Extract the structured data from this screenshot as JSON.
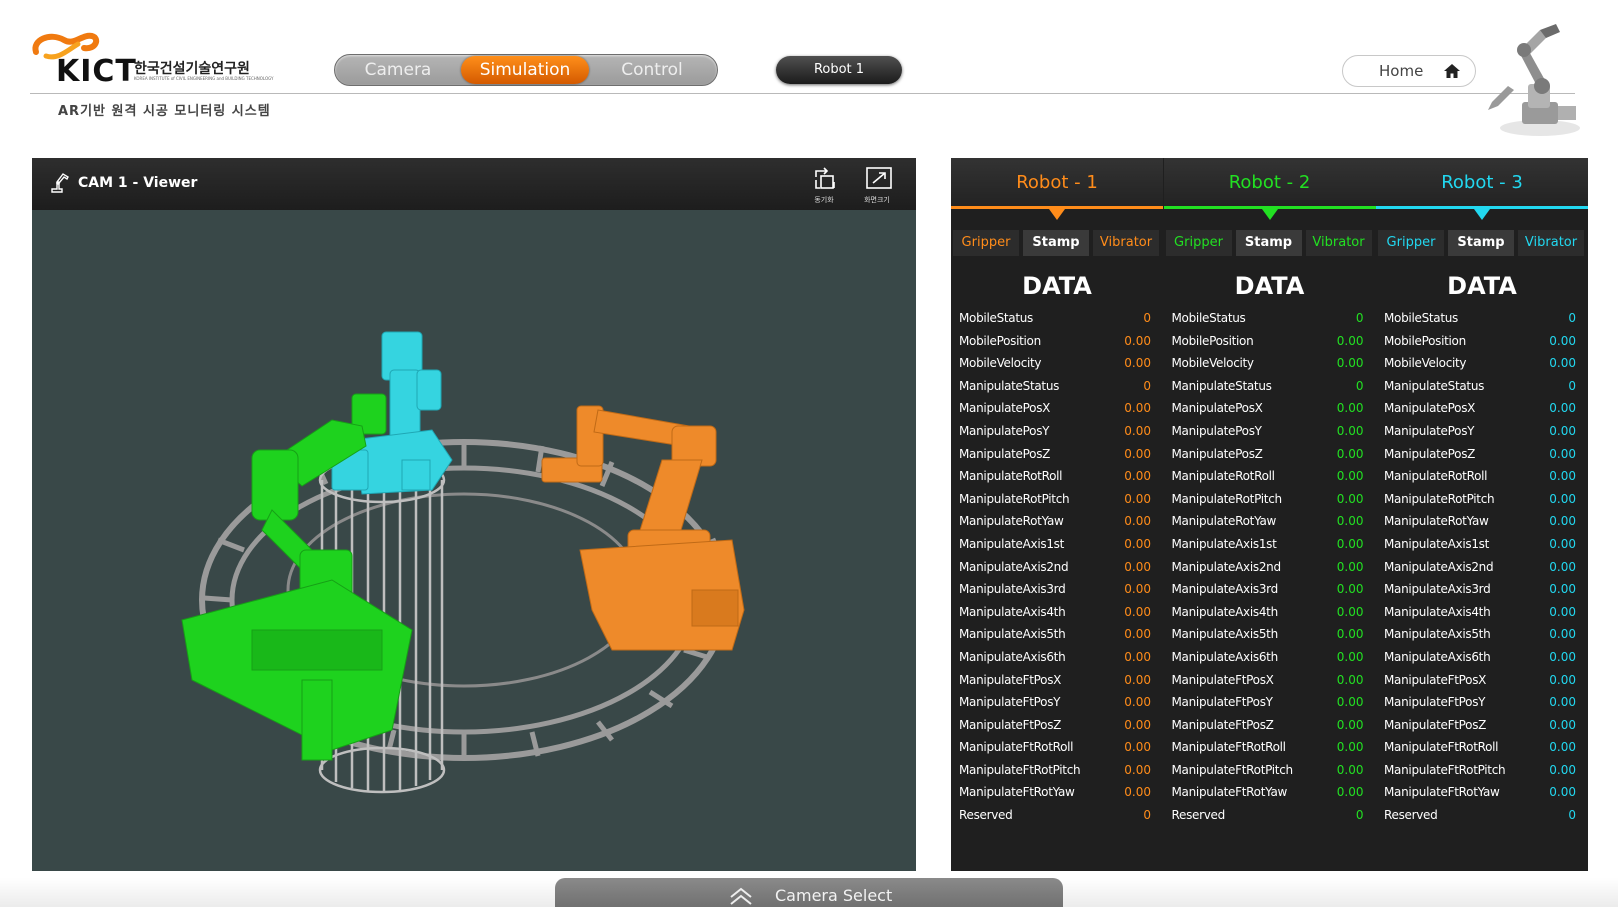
{
  "header": {
    "logo_text": "KICT",
    "logo_korean": "한국건설기술연구원",
    "logo_english": "KOREA INSTITUTE of CIVIL ENGINEERING and BUILDING TECHNOLOGY",
    "subtitle": "AR기반 원격 시공 모니터링 시스템",
    "modes": [
      {
        "label": "Camera"
      },
      {
        "label": "Simulation",
        "active": true
      },
      {
        "label": "Control"
      }
    ],
    "robot_select": "Robot 1",
    "home_label": "Home",
    "icons": {
      "home": "home-icon",
      "logo": "kict-logo-icon",
      "robot_arm": "robot-arm-icon"
    }
  },
  "viewer": {
    "title": "CAM 1 - Viewer",
    "buttons": [
      {
        "label": "동기화",
        "icon": "sync-icon"
      },
      {
        "label": "화면크기",
        "icon": "fullscreen-icon"
      }
    ]
  },
  "robots": [
    {
      "name": "Robot - 1",
      "color": "#ff8c1a",
      "tools": [
        "Gripper",
        "Stamp",
        "Vibrator"
      ],
      "selected_tool": "Stamp",
      "data_title": "DATA",
      "rows": [
        [
          "MobileStatus",
          "0"
        ],
        [
          "MobilePosition",
          "0.00"
        ],
        [
          "MobileVelocity",
          "0.00"
        ],
        [
          "ManipulateStatus",
          "0"
        ],
        [
          "ManipulatePosX",
          "0.00"
        ],
        [
          "ManipulatePosY",
          "0.00"
        ],
        [
          "ManipulatePosZ",
          "0.00"
        ],
        [
          "ManipulateRotRoll",
          "0.00"
        ],
        [
          "ManipulateRotPitch",
          "0.00"
        ],
        [
          "ManipulateRotYaw",
          "0.00"
        ],
        [
          "ManipulateAxis1st",
          "0.00"
        ],
        [
          "ManipulateAxis2nd",
          "0.00"
        ],
        [
          "ManipulateAxis3rd",
          "0.00"
        ],
        [
          "ManipulateAxis4th",
          "0.00"
        ],
        [
          "ManipulateAxis5th",
          "0.00"
        ],
        [
          "ManipulateAxis6th",
          "0.00"
        ],
        [
          "ManipulateFtPosX",
          "0.00"
        ],
        [
          "ManipulateFtPosY",
          "0.00"
        ],
        [
          "ManipulateFtPosZ",
          "0.00"
        ],
        [
          "ManipulateFtRotRoll",
          "0.00"
        ],
        [
          "ManipulateFtRotPitch",
          "0.00"
        ],
        [
          "ManipulateFtRotYaw",
          "0.00"
        ],
        [
          "Reserved",
          "0"
        ]
      ]
    },
    {
      "name": "Robot - 2",
      "color": "#22e022",
      "tools": [
        "Gripper",
        "Stamp",
        "Vibrator"
      ],
      "selected_tool": "Stamp",
      "data_title": "DATA",
      "rows": [
        [
          "MobileStatus",
          "0"
        ],
        [
          "MobilePosition",
          "0.00"
        ],
        [
          "MobileVelocity",
          "0.00"
        ],
        [
          "ManipulateStatus",
          "0"
        ],
        [
          "ManipulatePosX",
          "0.00"
        ],
        [
          "ManipulatePosY",
          "0.00"
        ],
        [
          "ManipulatePosZ",
          "0.00"
        ],
        [
          "ManipulateRotRoll",
          "0.00"
        ],
        [
          "ManipulateRotPitch",
          "0.00"
        ],
        [
          "ManipulateRotYaw",
          "0.00"
        ],
        [
          "ManipulateAxis1st",
          "0.00"
        ],
        [
          "ManipulateAxis2nd",
          "0.00"
        ],
        [
          "ManipulateAxis3rd",
          "0.00"
        ],
        [
          "ManipulateAxis4th",
          "0.00"
        ],
        [
          "ManipulateAxis5th",
          "0.00"
        ],
        [
          "ManipulateAxis6th",
          "0.00"
        ],
        [
          "ManipulateFtPosX",
          "0.00"
        ],
        [
          "ManipulateFtPosY",
          "0.00"
        ],
        [
          "ManipulateFtPosZ",
          "0.00"
        ],
        [
          "ManipulateFtRotRoll",
          "0.00"
        ],
        [
          "ManipulateFtRotPitch",
          "0.00"
        ],
        [
          "ManipulateFtRotYaw",
          "0.00"
        ],
        [
          "Reserved",
          "0"
        ]
      ]
    },
    {
      "name": "Robot - 3",
      "color": "#22d8f0",
      "tools": [
        "Gripper",
        "Stamp",
        "Vibrator"
      ],
      "selected_tool": "Stamp",
      "data_title": "DATA",
      "rows": [
        [
          "MobileStatus",
          "0"
        ],
        [
          "MobilePosition",
          "0.00"
        ],
        [
          "MobileVelocity",
          "0.00"
        ],
        [
          "ManipulateStatus",
          "0"
        ],
        [
          "ManipulatePosX",
          "0.00"
        ],
        [
          "ManipulatePosY",
          "0.00"
        ],
        [
          "ManipulatePosZ",
          "0.00"
        ],
        [
          "ManipulateRotRoll",
          "0.00"
        ],
        [
          "ManipulateRotPitch",
          "0.00"
        ],
        [
          "ManipulateRotYaw",
          "0.00"
        ],
        [
          "ManipulateAxis1st",
          "0.00"
        ],
        [
          "ManipulateAxis2nd",
          "0.00"
        ],
        [
          "ManipulateAxis3rd",
          "0.00"
        ],
        [
          "ManipulateAxis4th",
          "0.00"
        ],
        [
          "ManipulateAxis5th",
          "0.00"
        ],
        [
          "ManipulateAxis6th",
          "0.00"
        ],
        [
          "ManipulateFtPosX",
          "0.00"
        ],
        [
          "ManipulateFtPosY",
          "0.00"
        ],
        [
          "ManipulateFtPosZ",
          "0.00"
        ],
        [
          "ManipulateFtRotRoll",
          "0.00"
        ],
        [
          "ManipulateFtRotPitch",
          "0.00"
        ],
        [
          "ManipulateFtRotYaw",
          "0.00"
        ],
        [
          "Reserved",
          "0"
        ]
      ]
    }
  ],
  "footer": {
    "camera_select": "Camera Select",
    "icon": "double-chevron-up-icon"
  },
  "colors": {
    "accent": "#e86a00",
    "panel_bg": "#1f1f1f",
    "viewer_bg": "#394848"
  }
}
